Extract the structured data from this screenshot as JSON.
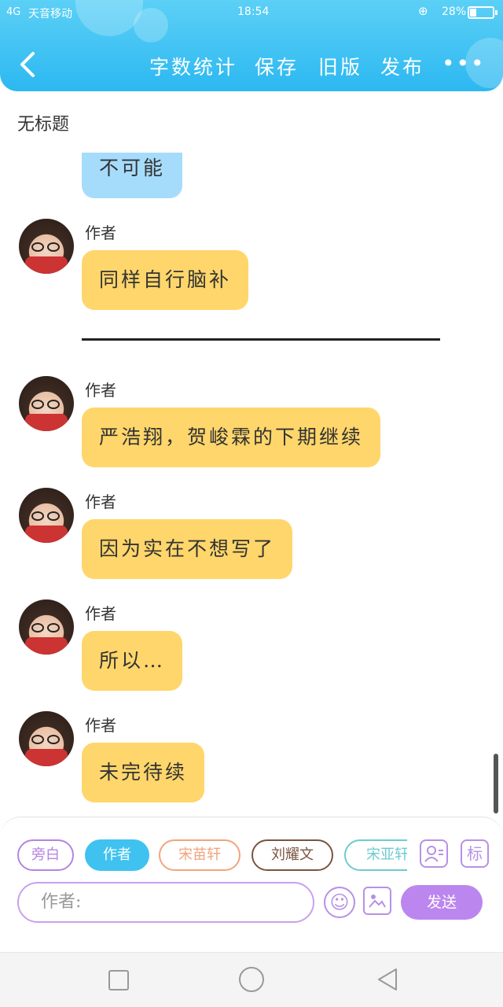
{
  "status_bar": {
    "signal": "4G",
    "carrier": "天音移动",
    "time": "18:54",
    "battery": "28%",
    "battery_fraction": 0.28
  },
  "header": {
    "back_icon": "chevron-left-icon",
    "actions": [
      "字数统计",
      "保存",
      "旧版",
      "发布"
    ],
    "more_icon": "more-horizontal-icon",
    "color_top": "#5cd0f6",
    "color_bottom": "#2cb8f1"
  },
  "doc_title": "无标题",
  "messages": [
    {
      "sender": "",
      "text": "不可能",
      "bubble": "blue"
    },
    {
      "sender": "作者",
      "text": "同样自行脑补",
      "bubble": "yellow"
    },
    {
      "divider": "———————————————"
    },
    {
      "sender": "作者",
      "text": "严浩翔，贺峻霖的下期继续",
      "bubble": "yellow"
    },
    {
      "sender": "作者",
      "text": "因为实在不想写了",
      "bubble": "yellow"
    },
    {
      "sender": "作者",
      "text": "所以…",
      "bubble": "yellow"
    },
    {
      "sender": "作者",
      "text": "未完待续",
      "bubble": "yellow"
    }
  ],
  "composer": {
    "roles": [
      "旁白",
      "作者",
      "宋苗轩",
      "刘耀文",
      "宋亚轩"
    ],
    "selected_role": "作者",
    "role_icon": "person-card-icon",
    "mark_label": "标",
    "input_placeholder": "作者:",
    "emoji_icon": "smiley-icon",
    "image_icon": "image-icon",
    "send_label": "发送",
    "accent": "#bc86ef"
  },
  "system_nav": {
    "recent_icon": "square-icon",
    "home_icon": "circle-icon",
    "back_icon": "triangle-back-icon"
  }
}
